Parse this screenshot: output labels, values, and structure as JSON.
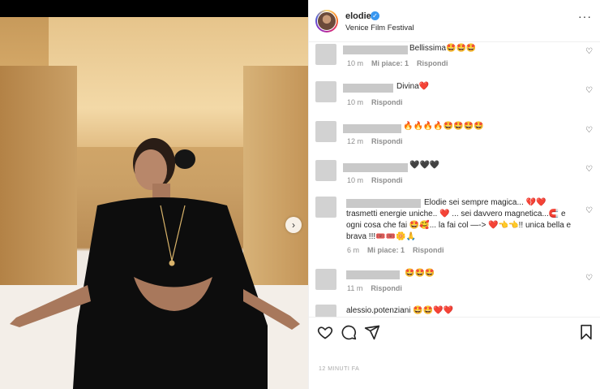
{
  "post": {
    "username": "elodie",
    "location": "Venice Film Festival",
    "time_ago": "12 MINUTI FA"
  },
  "icons": {
    "verified": "verified-check-icon",
    "more": "more-options-icon",
    "next": "chevron-right-icon",
    "like": "heart-icon",
    "comment": "comment-icon",
    "share": "paper-plane-icon",
    "save": "bookmark-icon"
  },
  "symbols": {
    "verified": "✓",
    "more": "···",
    "next": "›",
    "heart": "♡"
  },
  "comments": [
    {
      "text": "Bellissima🤩🤩🤩",
      "time": "10 m",
      "likes": "Mi piace: 1",
      "reply": "Rispondi"
    },
    {
      "text": "Divina❤️",
      "time": "10 m",
      "likes": "",
      "reply": "Rispondi"
    },
    {
      "text": "🔥🔥🔥🔥🤩🤩🤩🤩",
      "time": "12 m",
      "likes": "",
      "reply": "Rispondi"
    },
    {
      "text": "🖤🖤🖤",
      "time": "10 m",
      "likes": "",
      "reply": "Rispondi"
    },
    {
      "text": "Elodie sei sempre magica... 💔❤️ trasmetti energie uniche.. ❤️ ... sei davvero magnetica...🧲 e ogni cosa che fai 🤩🥰... la fai col —-> ❤️👈👈!! unica bella e brava !!!🎟️🎟️🌼🙏",
      "time": "6 m",
      "likes": "Mi piace: 1",
      "reply": "Rispondi"
    },
    {
      "text": "🤩🤩🤩",
      "time": "11 m",
      "likes": "",
      "reply": "Rispondi"
    },
    {
      "text": "alessio.potenziani 🤩🤩❤️❤️",
      "time": "",
      "likes": "",
      "reply": ""
    }
  ],
  "colors": {
    "accent": "#3897f0",
    "muted": "#8e8e8e",
    "text": "#262626"
  }
}
